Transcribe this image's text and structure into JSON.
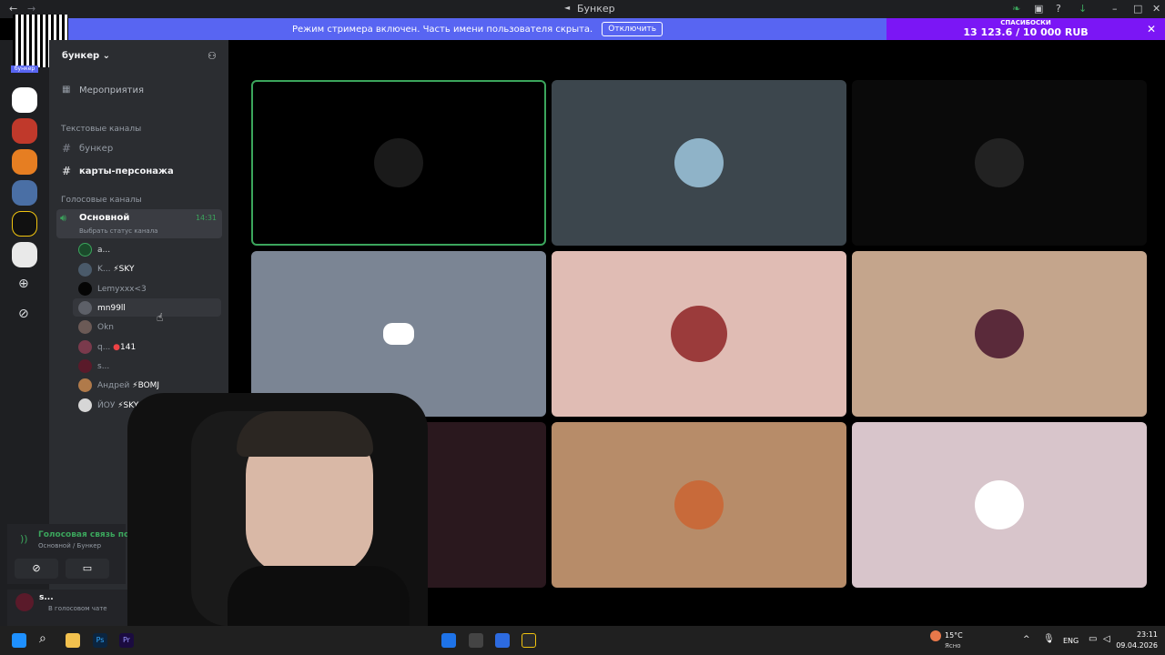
{
  "window": {
    "title": "Бункер"
  },
  "banner": {
    "text": "Режим стримера включен. Часть имени пользователя скрыта.",
    "button": "Отключить"
  },
  "donation": {
    "label": "СПАСИБОСКИ",
    "amount": "13 123.6 / 10 000 RUB"
  },
  "qr_label": "бункер",
  "server": {
    "name": "бункер"
  },
  "sidebar": {
    "events": "Мероприятия",
    "text_category": "Текстовые каналы",
    "text_channels": [
      "бункер",
      "карты-персонажа"
    ],
    "voice_category": "Голосовые каналы",
    "voice_channel": {
      "name": "Основной",
      "time": "14:31",
      "status": "Выбрать статус канала"
    },
    "members": [
      {
        "name": "a...",
        "tag": ""
      },
      {
        "name": "K...",
        "tag": "⚡SKY"
      },
      {
        "name": "Lemyxxx<3",
        "tag": ""
      },
      {
        "name": "mn99ll",
        "tag": ""
      },
      {
        "name": "Okn",
        "tag": ""
      },
      {
        "name": "q...",
        "tag": "141"
      },
      {
        "name": "s...",
        "tag": ""
      },
      {
        "name": "Андрей",
        "tag": "⚡BOMJ"
      },
      {
        "name": "ЙОУ",
        "tag": "⚡SKY"
      }
    ],
    "voice_panel": {
      "status": "Голосовая связь по...",
      "channel": "Основной / Бункер"
    },
    "user": {
      "name": "s...",
      "status": "В голосовом чате"
    }
  },
  "tiles_colors": [
    "#000000",
    "#3c464d",
    "#0a0a0a",
    "#7b8594",
    "#e0bcb4",
    "#c4a58c",
    "#2a181e",
    "#b78c69",
    "#d8c5cb"
  ],
  "taskbar": {
    "weather_temp": "15°C",
    "weather_desc": "Ясно",
    "lang": "ENG",
    "time": "23:11",
    "date": "09.04.2026"
  }
}
